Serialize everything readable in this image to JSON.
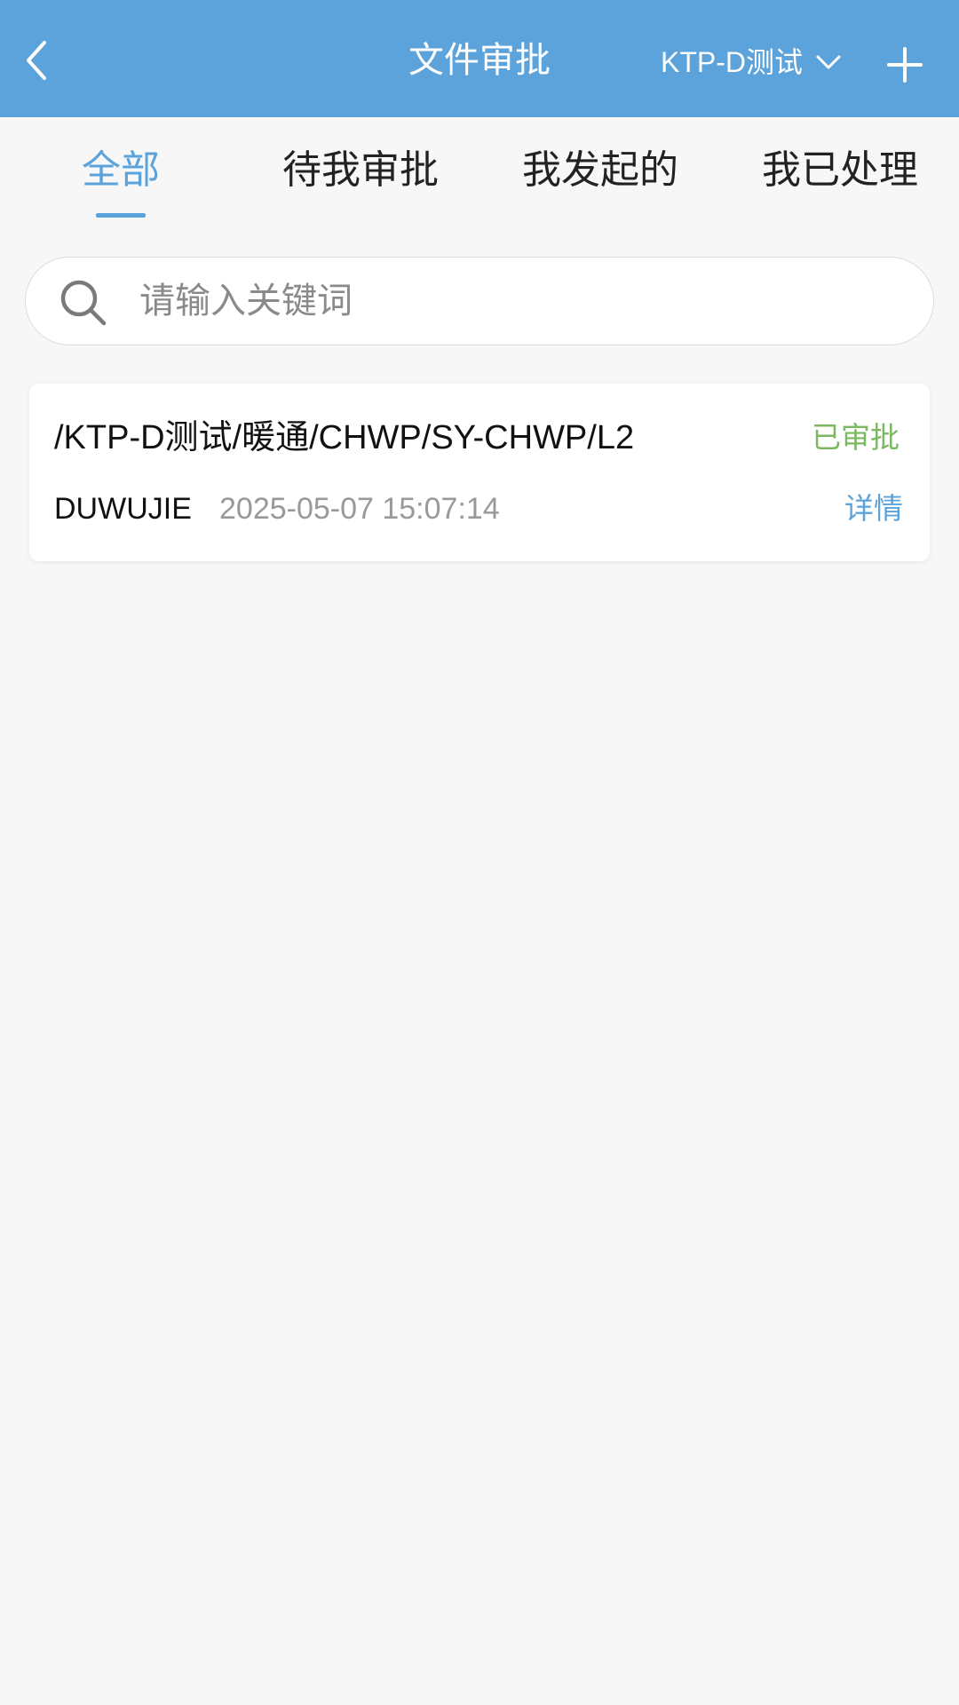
{
  "header": {
    "title": "文件审批",
    "project": "KTP-D测试",
    "back_icon": "chevron-left-icon",
    "dropdown_icon": "chevron-down-icon",
    "add_icon": "plus-icon"
  },
  "tabs": [
    {
      "label": "全部",
      "active": true
    },
    {
      "label": "待我审批",
      "active": false
    },
    {
      "label": "我发起的",
      "active": false
    },
    {
      "label": "我已处理",
      "active": false
    }
  ],
  "search": {
    "placeholder": "请输入关键词",
    "value": "",
    "icon": "search-icon"
  },
  "items": [
    {
      "path": "/KTP-D测试/暖通/CHWP/SY-CHWP/L2",
      "status": "已审批",
      "user": "DUWUJIE",
      "time": "2025-05-07 15:07:14",
      "detail_label": "详情"
    }
  ],
  "colors": {
    "header_bg": "#5ba3da",
    "accent": "#5ba3da",
    "approved": "#7cb862",
    "page_bg": "#f7f7f7"
  }
}
